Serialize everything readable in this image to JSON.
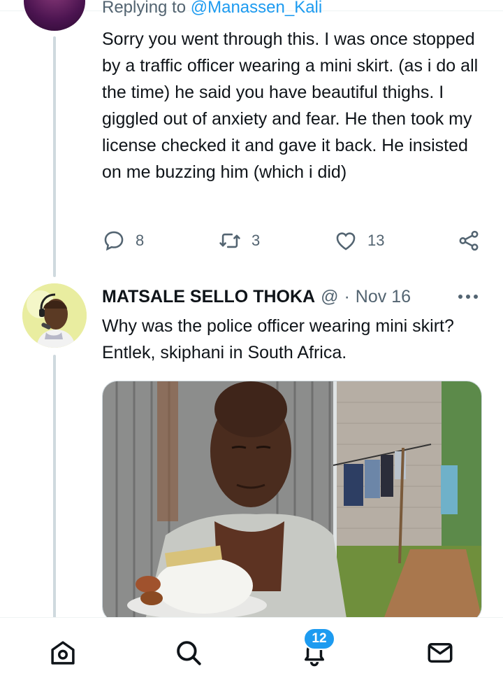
{
  "reply_tweet": {
    "reply_prefix": "Replying to",
    "reply_handle": "@Manassen_Kali",
    "text": "Sorry you went through this. I was once stopped by a traffic officer wearing a mini skirt. (as i do all the time) he said you have beautiful thighs. I giggled out of anxiety and fear. He then took my license checked it and gave it back. He insisted on me buzzing him (which i did)",
    "actions": {
      "reply_count": "8",
      "retweet_count": "3",
      "like_count": "13"
    }
  },
  "quote_tweet": {
    "display_name": "MATSALE SELLO THOKA",
    "handle": "@",
    "separator": "·",
    "date": "Nov 16",
    "text": "Why was the police officer wearing mini skirt? Entlek, skiphani in South Africa."
  },
  "bottom_nav": {
    "notifications_badge": "12"
  },
  "colors": {
    "accent": "#1d9bf0",
    "muted_text": "#536471",
    "thread_line": "#cfd9de"
  },
  "icons": [
    "home-icon",
    "search-icon",
    "notifications-icon",
    "messages-icon",
    "reply-icon",
    "retweet-icon",
    "like-icon",
    "share-icon",
    "more-icon"
  ]
}
